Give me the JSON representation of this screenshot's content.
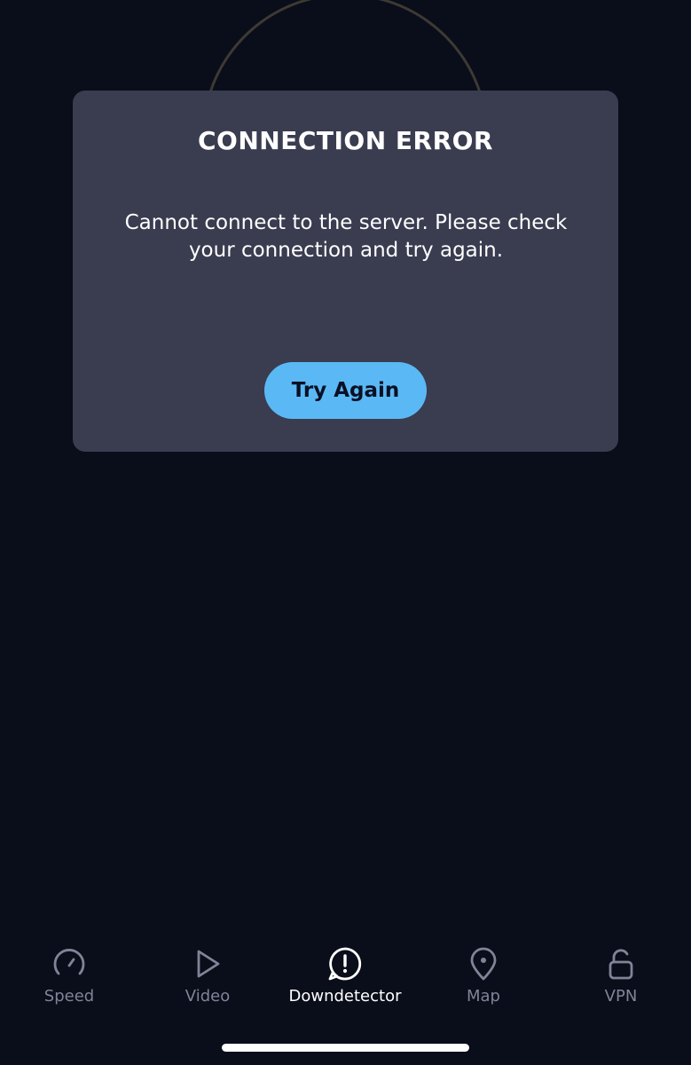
{
  "dialog": {
    "title": "CONNECTION ERROR",
    "message": "Cannot connect to the server. Please check your connection and try again.",
    "retry_label": "Try Again"
  },
  "tabs": [
    {
      "label": "Speed",
      "icon": "speedometer-icon",
      "active": false
    },
    {
      "label": "Video",
      "icon": "play-icon",
      "active": false
    },
    {
      "label": "Downdetector",
      "icon": "alert-bubble-icon",
      "active": true
    },
    {
      "label": "Map",
      "icon": "map-pin-icon",
      "active": false
    },
    {
      "label": "VPN",
      "icon": "unlock-icon",
      "active": false
    }
  ],
  "colors": {
    "background": "#0a0d1a",
    "dialog": "#3a3c50",
    "accent": "#5ab9f5",
    "inactive_tab": "#7f8497",
    "active_tab": "#ffffff"
  }
}
